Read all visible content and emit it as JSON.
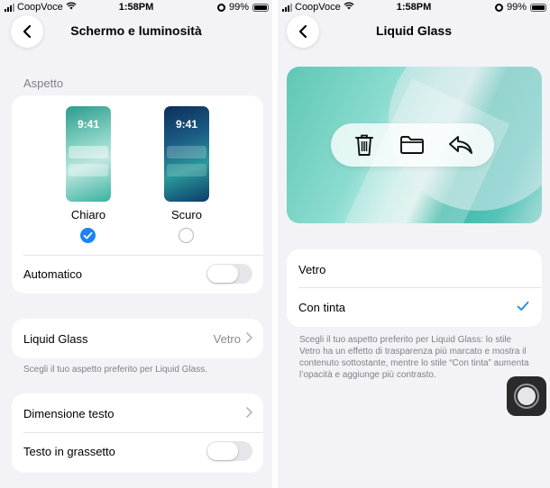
{
  "status_bar": {
    "carrier": "CoopVoce",
    "time": "1:58PM",
    "battery": "99%"
  },
  "left_screen": {
    "title": "Schermo e luminosità",
    "section_appearance": "Aspetto",
    "options": [
      {
        "label": "Chiaro",
        "preview_time": "9:41",
        "selected": true
      },
      {
        "label": "Scuro",
        "preview_time": "9:41",
        "selected": false
      }
    ],
    "automatic_label": "Automatico",
    "automatic_on": false,
    "liquid_glass_label": "Liquid Glass",
    "liquid_glass_value": "Vetro",
    "liquid_glass_footnote": "Scegli il tuo aspetto preferito per Liquid Glass.",
    "text_size_label": "Dimensione testo",
    "bold_text_label": "Testo in grassetto",
    "bold_text_on": false
  },
  "right_screen": {
    "title": "Liquid Glass",
    "preview_icons": [
      "trash-icon",
      "folder-icon",
      "reply-icon"
    ],
    "options": [
      {
        "label": "Vetro",
        "selected": false
      },
      {
        "label": "Con tinta",
        "selected": true
      }
    ],
    "footnote": "Scegli il tuo aspetto preferito per Liquid Glass: lo stile Vetro ha un effetto di trasparenza più marcato e mostra il contenuto sottostante, mentre lo stile “Con tinta” aumenta l’opacità e aggiunge più contrasto."
  },
  "colors": {
    "accent": "#1a84f5",
    "background": "#f2f2f7",
    "card": "#ffffff",
    "secondary_text": "#808086"
  }
}
